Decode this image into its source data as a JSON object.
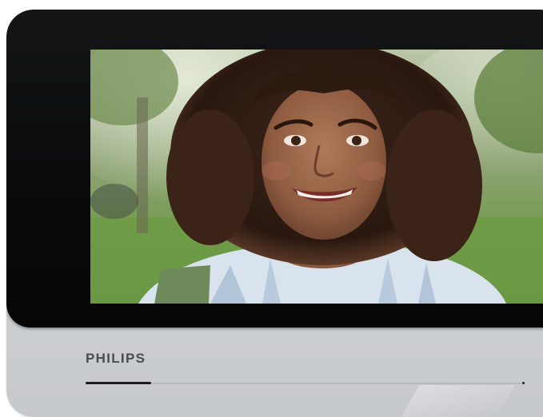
{
  "device": {
    "brand_label": "PHILIPS"
  },
  "screen": {
    "content": "video-call-image"
  },
  "progress": {
    "fill_fraction": 0.15
  },
  "colors": {
    "bezel": "#0b0b0c",
    "body": "#d2d5d8",
    "brand_text": "#4a4d52",
    "progress_fill": "#1c1c1e"
  }
}
